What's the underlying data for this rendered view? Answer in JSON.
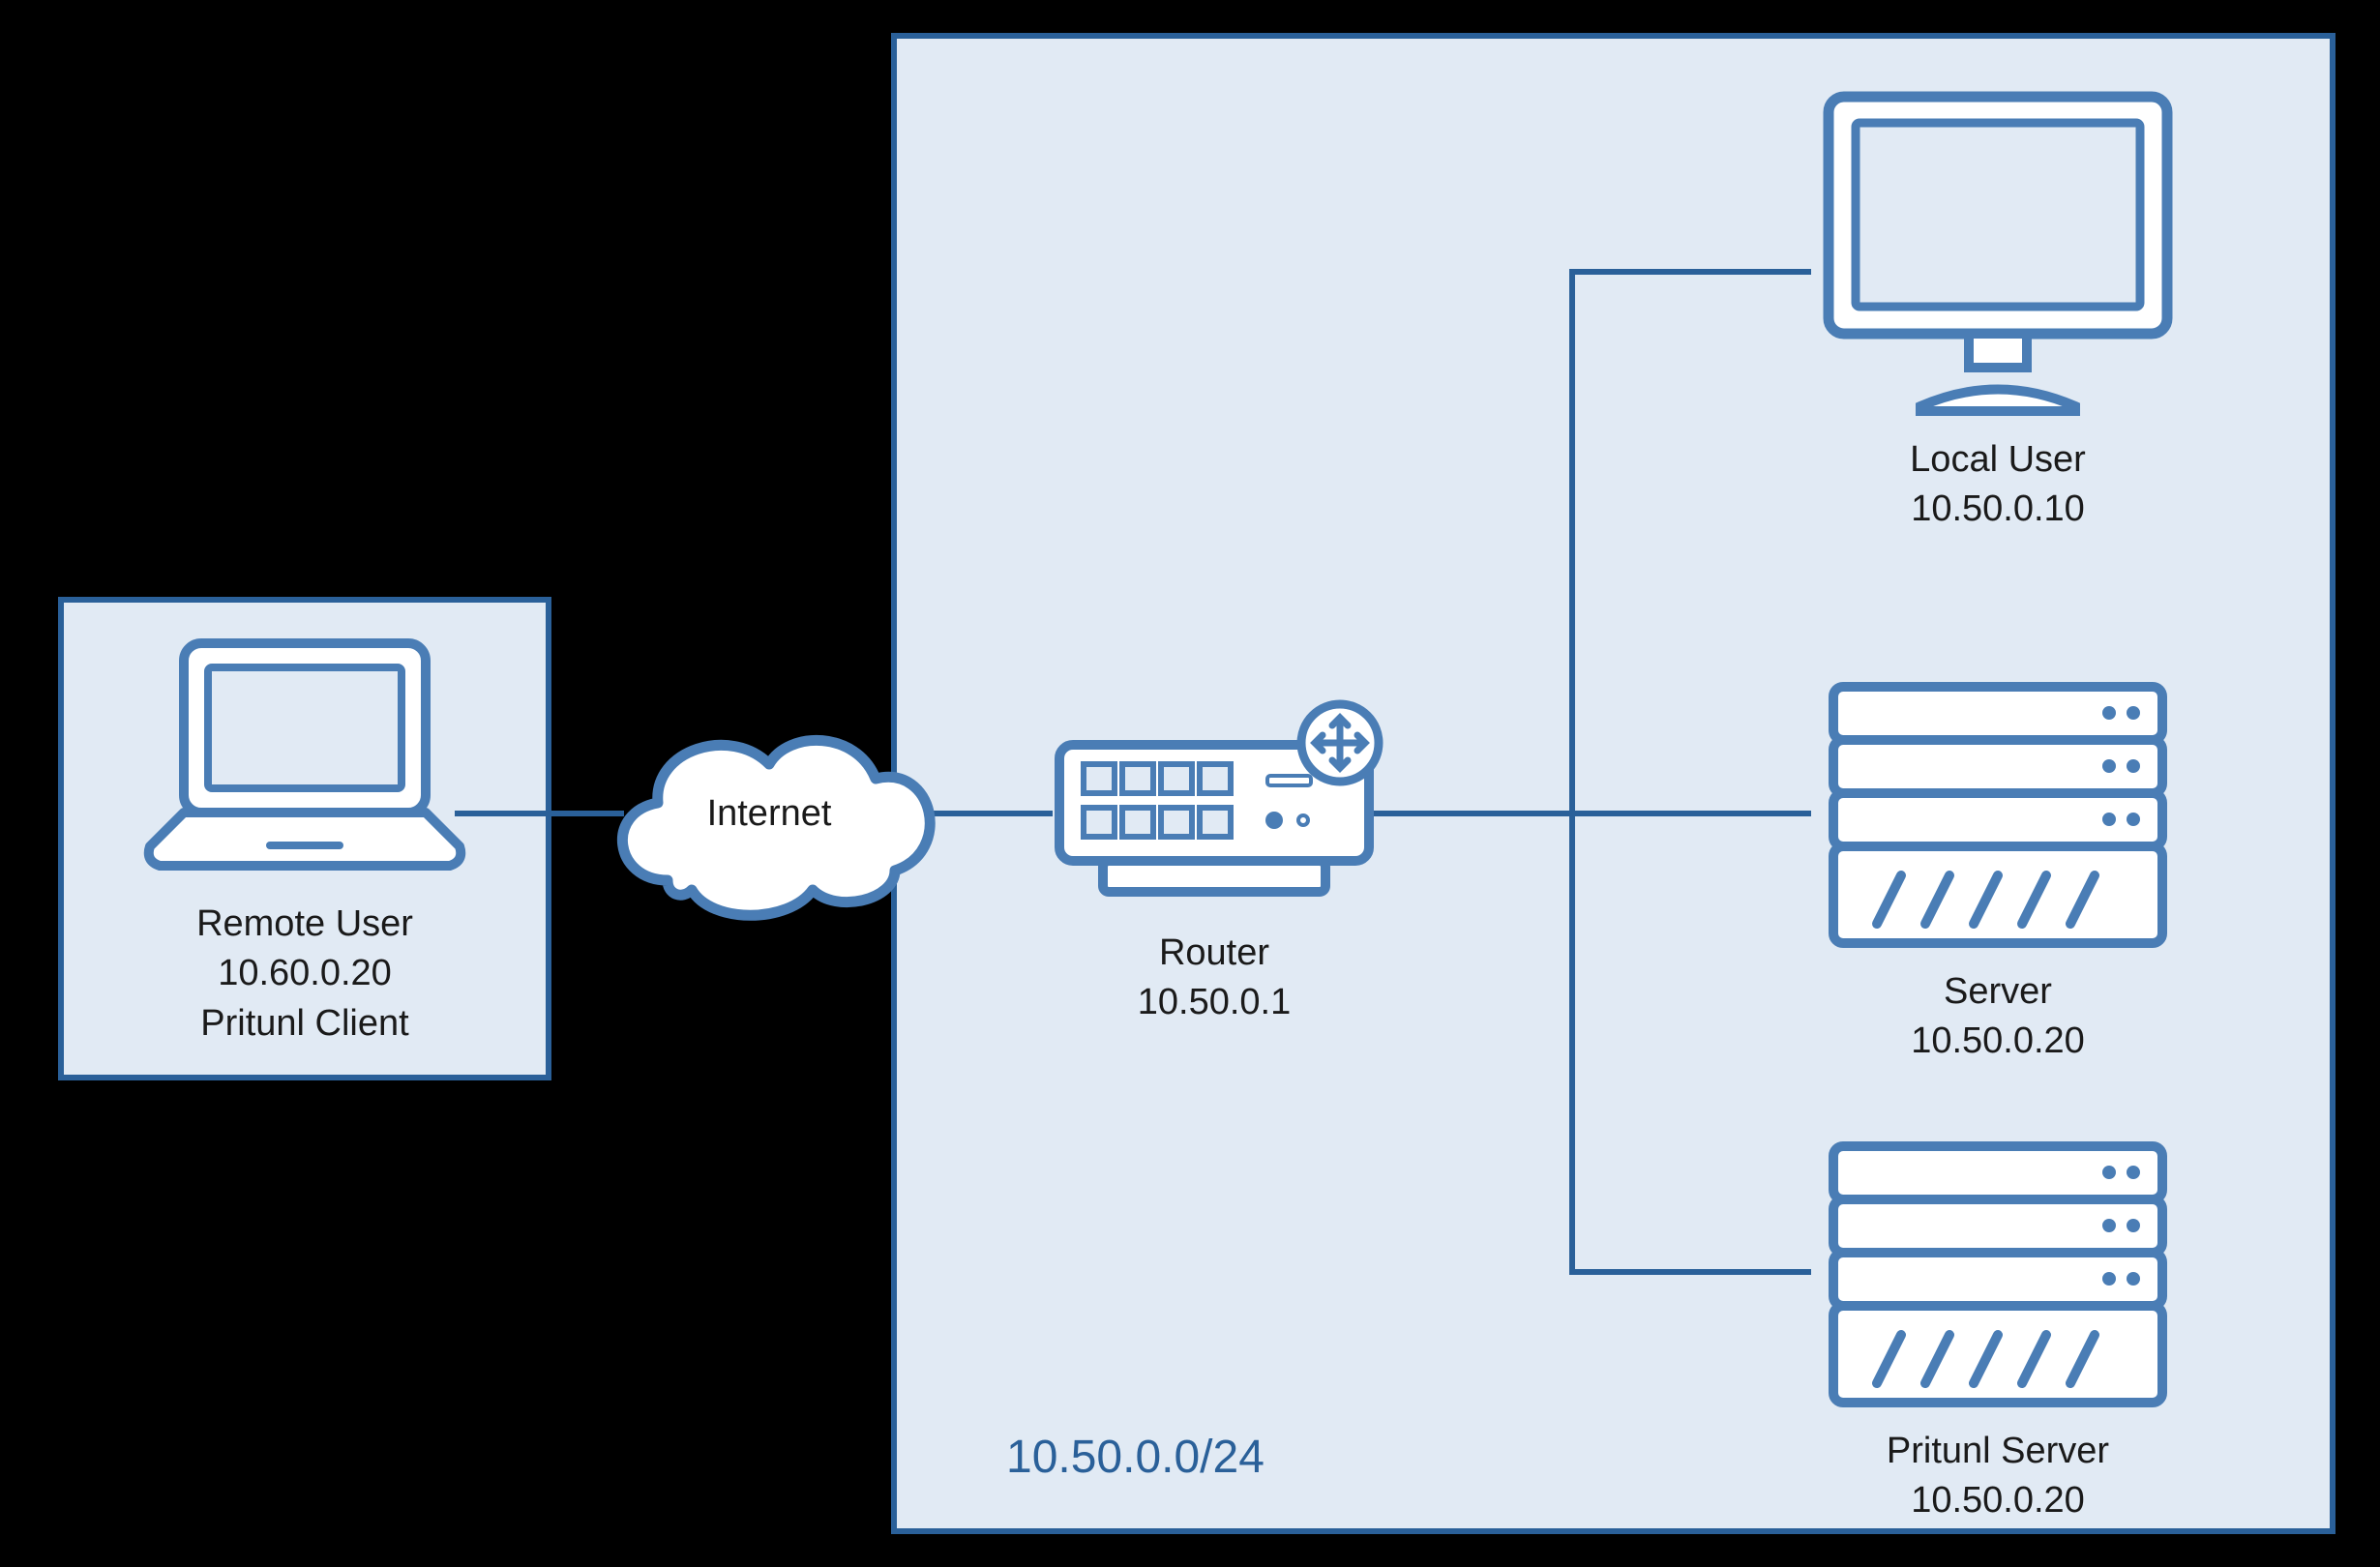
{
  "diagram": {
    "subnet_label": "10.50.0.0/24",
    "internet_label": "Internet",
    "colors": {
      "line": "#2a6099",
      "fill": "#e1eaf4",
      "icon_stroke": "#4a7db5",
      "icon_fill": "#ffffff"
    }
  },
  "nodes": {
    "remote_user": {
      "label": "Remote User\n10.60.0.20\nPritunl Client"
    },
    "router": {
      "label": "Router\n10.50.0.1"
    },
    "local_user": {
      "label": "Local User\n10.50.0.10"
    },
    "server": {
      "label": "Server\n10.50.0.20"
    },
    "pritunl_server": {
      "label": "Pritunl Server\n10.50.0.20"
    }
  }
}
